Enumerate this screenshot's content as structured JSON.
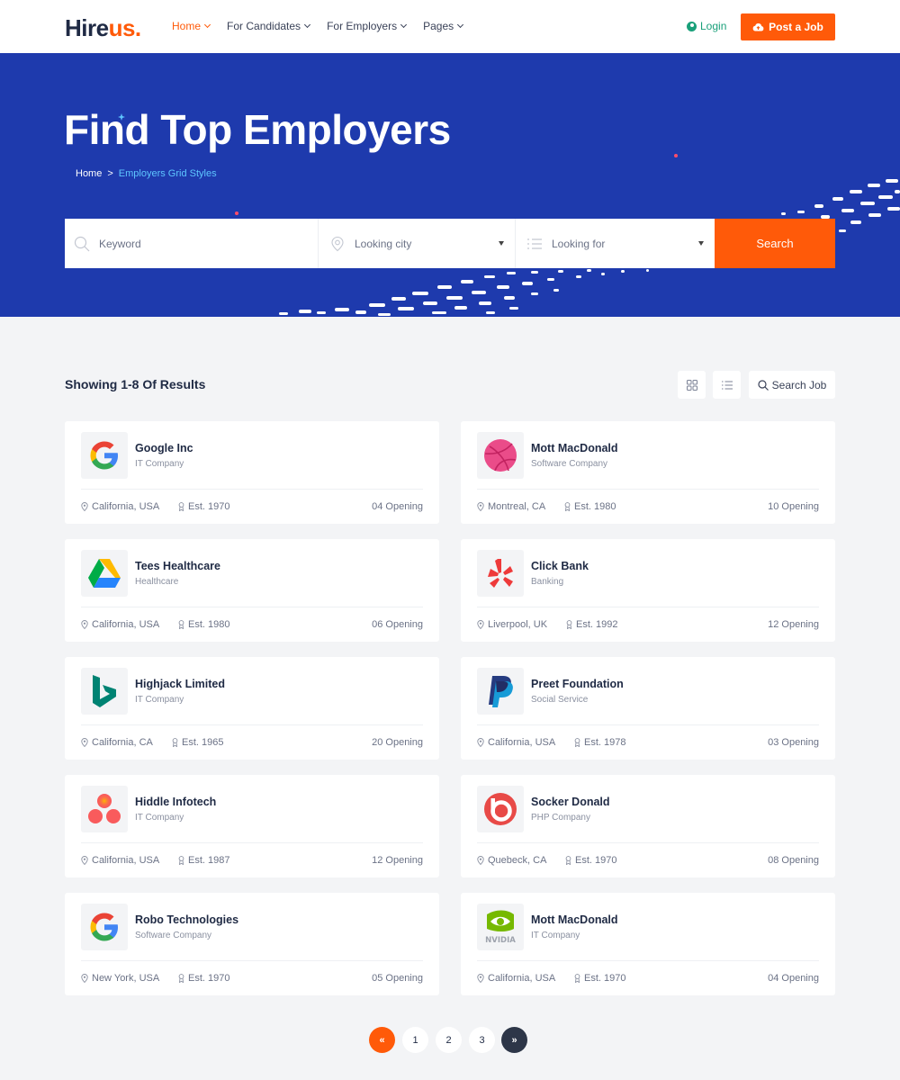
{
  "header": {
    "logo_main": "Hire",
    "logo_accent": "us.",
    "nav": [
      {
        "label": "Home",
        "active": true
      },
      {
        "label": "For Candidates",
        "active": false
      },
      {
        "label": "For Employers",
        "active": false
      },
      {
        "label": "Pages",
        "active": false
      }
    ],
    "login_label": "Login",
    "post_job_label": "Post a Job"
  },
  "hero": {
    "title": "Find Top Employers",
    "breadcrumb_home": "Home",
    "breadcrumb_sep": ">",
    "breadcrumb_current": "Employers Grid Styles"
  },
  "search": {
    "keyword_placeholder": "Keyword",
    "city_placeholder": "Looking city",
    "for_placeholder": "Looking for",
    "button_label": "Search"
  },
  "results": {
    "summary": "Showing 1-8 Of Results",
    "search_job_label": "Search Job"
  },
  "companies": [
    {
      "name": "Google Inc",
      "type": "IT Company",
      "location": "California, USA",
      "est": "Est. 1970",
      "openings": "04 Opening",
      "logo": "google-logo"
    },
    {
      "name": "Mott MacDonald",
      "type": "Software Company",
      "location": "Montreal, CA",
      "est": "Est. 1980",
      "openings": "10 Opening",
      "logo": "dribbble-logo"
    },
    {
      "name": "Tees Healthcare",
      "type": "Healthcare",
      "location": "California, USA",
      "est": "Est. 1980",
      "openings": "06 Opening",
      "logo": "google-drive-logo"
    },
    {
      "name": "Click Bank",
      "type": "Banking",
      "location": "Liverpool, UK",
      "est": "Est. 1992",
      "openings": "12 Opening",
      "logo": "yelp-logo"
    },
    {
      "name": "Highjack Limited",
      "type": "IT Company",
      "location": "California, CA",
      "est": "Est. 1965",
      "openings": "20 Opening",
      "logo": "bing-logo"
    },
    {
      "name": "Preet Foundation",
      "type": "Social Service",
      "location": "California, USA",
      "est": "Est. 1978",
      "openings": "03 Opening",
      "logo": "paypal-logo"
    },
    {
      "name": "Hiddle Infotech",
      "type": "IT Company",
      "location": "California, USA",
      "est": "Est. 1987",
      "openings": "12 Opening",
      "logo": "asana-logo"
    },
    {
      "name": "Socker Donald",
      "type": "PHP Company",
      "location": "Quebeck, CA",
      "est": "Est. 1970",
      "openings": "08 Opening",
      "logo": "beats-logo"
    },
    {
      "name": "Robo Technologies",
      "type": "Software Company",
      "location": "New York, USA",
      "est": "Est. 1970",
      "openings": "05 Opening",
      "logo": "google-logo"
    },
    {
      "name": "Mott MacDonald",
      "type": "IT Company",
      "location": "California, USA",
      "est": "Est. 1970",
      "openings": "04 Opening",
      "logo": "nvidia-logo"
    }
  ],
  "nvidia_wordmark": "NVIDIA",
  "pagination": {
    "prev": "«",
    "pages": [
      "1",
      "2",
      "3"
    ],
    "next": "»"
  },
  "colors": {
    "brand": "#ff5a09",
    "hero_bg": "#1e3aad",
    "login": "#1aa07a",
    "breadcrumb_current": "#5ec6ff"
  }
}
